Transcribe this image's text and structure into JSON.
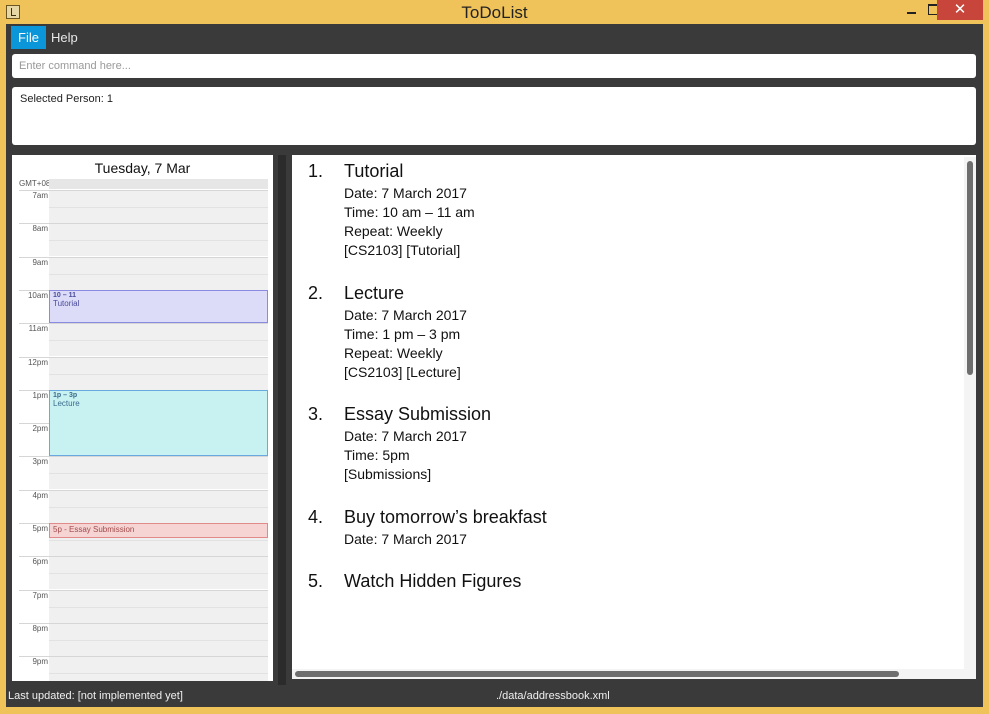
{
  "window": {
    "title": "ToDoList",
    "close_glyph": "✕"
  },
  "menu": {
    "items": [
      {
        "label": "File"
      },
      {
        "label": "Help"
      }
    ]
  },
  "command": {
    "placeholder": "Enter command here...",
    "value": ""
  },
  "result": {
    "text": "Selected Person: 1"
  },
  "calendar": {
    "date_header": "Tuesday, 7 Mar",
    "timezone": "GMT+08",
    "hours": [
      "7am",
      "8am",
      "9am",
      "10am",
      "11am",
      "12pm",
      "1pm",
      "2pm",
      "3pm",
      "4pm",
      "5pm",
      "6pm",
      "7pm",
      "8pm",
      "9pm"
    ],
    "events": [
      {
        "time": "10 – 11",
        "title": "Tutorial"
      },
      {
        "time": "1p – 3p",
        "title": "Lecture"
      },
      {
        "label": "5p - Essay Submission"
      }
    ]
  },
  "tasks": [
    {
      "index": "1.",
      "name": "Tutorial",
      "details": [
        "Date: 7 March 2017",
        "Time: 10 am – 11 am",
        "Repeat: Weekly",
        "[CS2103] [Tutorial]"
      ]
    },
    {
      "index": "2.",
      "name": "Lecture",
      "details": [
        "Date: 7 March 2017",
        "Time: 1 pm – 3 pm",
        "Repeat: Weekly",
        "[CS2103] [Lecture]"
      ]
    },
    {
      "index": "3.",
      "name": "Essay Submission",
      "details": [
        "Date: 7 March 2017",
        "Time: 5pm",
        "[Submissions]"
      ]
    },
    {
      "index": "4.",
      "name": "Buy tomorrow’s breakfast",
      "details": [
        "Date: 7 March 2017"
      ]
    },
    {
      "index": "5.",
      "name": "Watch Hidden Figures",
      "details": []
    }
  ],
  "status": {
    "left": "Last updated: [not implemented yet]",
    "center": "./data/addressbook.xml"
  },
  "colors": {
    "window_frame": "#f0c35a",
    "background": "#3a3a3a",
    "menu_selected": "#0a96d8",
    "close_button": "#c7453a",
    "event_tutorial": "#dcdcf8",
    "event_lecture": "#c8f2f2",
    "event_essay": "#f6d4d4"
  }
}
